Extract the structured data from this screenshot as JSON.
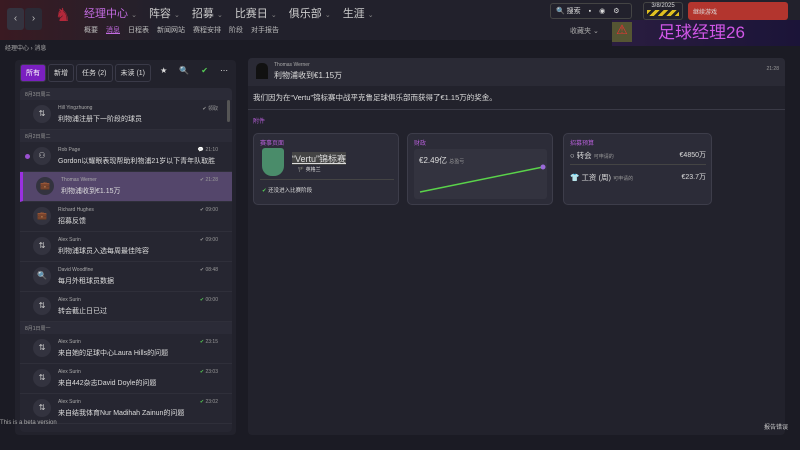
{
  "nav": {
    "menu": [
      "经理中心",
      "阵容",
      "招募",
      "比赛日",
      "俱乐部",
      "生涯"
    ],
    "sub": [
      "概要",
      "消息",
      "日程表",
      "新闻网站",
      "赛程安排",
      "阶段",
      "对手报告"
    ]
  },
  "tools": {
    "search": "搜索"
  },
  "date": "3/8/2025",
  "continue": "继续游戏",
  "favorites": "收藏夹",
  "logo": "足球经理26",
  "breadcrumb": {
    "root": "经理中心",
    "current": "消息"
  },
  "tabs": [
    "所有",
    "新增",
    "任务 (2)",
    "未读 (1)"
  ],
  "groups": [
    {
      "date": "8月3日周三",
      "items": [
        {
          "name": "Hill Yingzhuong",
          "subject": "利物浦注册下一阶段的球员",
          "time": "领取",
          "icon": "transfer",
          "ok": false
        }
      ]
    },
    {
      "date": "8月2日周二",
      "items": [
        {
          "name": "Rob Page",
          "subject": "Gordon以耀眼表现帮助利物浦21岁以下青年队取胜",
          "time": "21:10",
          "icon": "team",
          "ok": false,
          "unread": true
        },
        {
          "name": "Thomas Werner",
          "subject": "利物浦收到€1.15万",
          "time": "21:28",
          "icon": "briefcase",
          "ok": false,
          "selected": true
        },
        {
          "name": "Richard Hughes",
          "subject": "招募反馈",
          "time": "09:00",
          "icon": "briefcase",
          "ok": false
        },
        {
          "name": "Alex Surin",
          "subject": "利物浦球员入选每周最佳阵容",
          "time": "09:00",
          "icon": "transfer",
          "ok": false
        },
        {
          "name": "David Woodfine",
          "subject": "每月外租球员数据",
          "time": "08:48",
          "icon": "search",
          "ok": false
        },
        {
          "name": "Alex Surin",
          "subject": "转会截止日已过",
          "time": "00:00",
          "icon": "transfer",
          "ok": true
        }
      ]
    },
    {
      "date": "8月1日周一",
      "items": [
        {
          "name": "Alex Surin",
          "subject": "来自她的足球中心Laura Hills的问题",
          "time": "23:15",
          "icon": "transfer",
          "ok": true
        },
        {
          "name": "Alex Surin",
          "subject": "来自442杂志David Doyle的问题",
          "time": "23:03",
          "icon": "transfer",
          "ok": true
        },
        {
          "name": "Alex Surin",
          "subject": "来自结我体育Nur Madihah Zainun的问题",
          "time": "23:02",
          "icon": "transfer",
          "ok": true
        }
      ]
    }
  ],
  "message": {
    "sender": "Thomas Werner",
    "subject": "利物浦收到€1.15万",
    "time": "21:28",
    "body": "我们因为在“Vertu”锦标赛中战平克鲁足球俱乐部而获得了€1.15万的奖金。",
    "attachments_label": "附件"
  },
  "cards": {
    "comp": {
      "title": "赛事页面",
      "name": "“Vertu”锦标赛",
      "country": "英格兰",
      "status": "还没进入比赛阶段"
    },
    "finance": {
      "title": "财政",
      "value": "€2.49亿",
      "label": "总盈亏"
    },
    "budget": {
      "title": "招募预算",
      "rows": [
        {
          "label": "转会",
          "sub": "可申请的",
          "value": "€4850万"
        },
        {
          "label": "工资 (周)",
          "sub": "可申请的",
          "value": "€23.7万"
        }
      ]
    }
  },
  "beta": "This is a beta version",
  "report": "报告错误"
}
